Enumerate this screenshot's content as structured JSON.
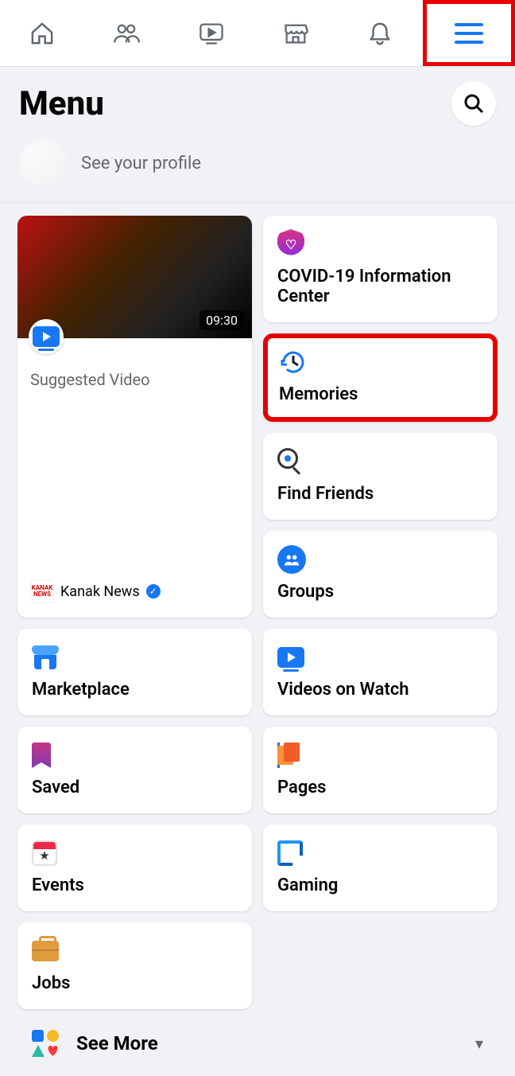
{
  "page_title": "Menu",
  "profile_subtitle": "See your profile",
  "video": {
    "duration": "09:30",
    "suggested_label": "Suggested Video",
    "source_name": "Kanak News"
  },
  "left_items": [
    {
      "label": "Groups"
    },
    {
      "label": "Videos on Watch"
    },
    {
      "label": "Pages"
    },
    {
      "label": "Gaming"
    }
  ],
  "right_items": [
    {
      "label": "COVID-19 Information Center"
    },
    {
      "label": "Memories"
    },
    {
      "label": "Find Friends"
    },
    {
      "label": "Marketplace"
    },
    {
      "label": "Saved"
    },
    {
      "label": "Events"
    },
    {
      "label": "Jobs"
    }
  ],
  "see_more": "See More"
}
